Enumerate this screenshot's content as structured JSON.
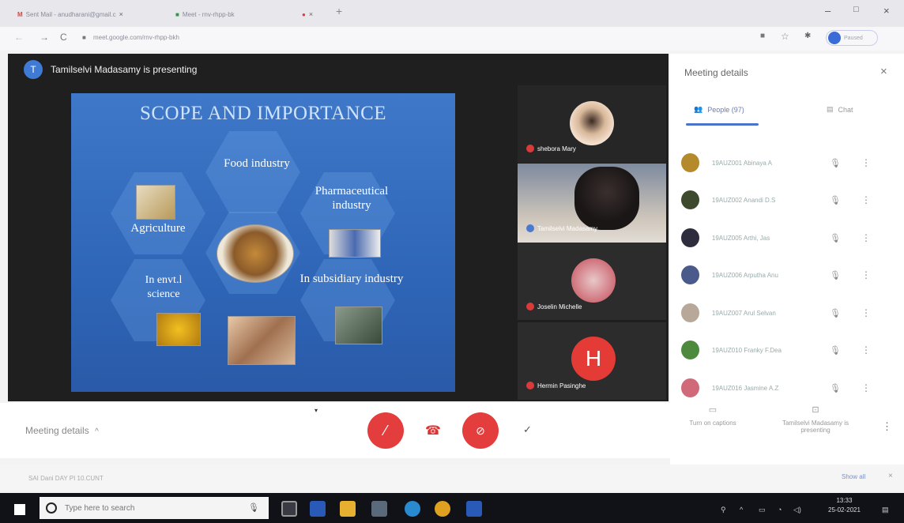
{
  "browser": {
    "tabs": [
      {
        "label": "Sent Mail - anudharani@gmail.c",
        "close": "×"
      },
      {
        "label": "Meet - rnv-rhpp-bk",
        "close": "×"
      }
    ],
    "rec_close": "×",
    "new_tab": "+",
    "window_controls": {
      "min": "–",
      "max": "□",
      "close": "×"
    },
    "nav": {
      "back": "←",
      "forward": "→",
      "reload": "C"
    },
    "url": "meet.google.com/rnv-rhpp-bkh",
    "profile_label": "Paused"
  },
  "meeting": {
    "presenter_initial": "T",
    "presenter_text": "Tamilselvi Madasamy is presenting",
    "slide": {
      "title": "SCOPE AND IMPORTANCE",
      "labels": {
        "food": "Food industry",
        "pharma": "Pharmaceutical industry",
        "agriculture": "Agriculture",
        "envt": "In envt.l science",
        "subsidiary": "In subsidiary industry"
      }
    },
    "tiles": [
      {
        "name": "shebora Mary"
      },
      {
        "name": "Tamilselvi Madasamy"
      },
      {
        "name": "Joselin Michelle"
      },
      {
        "name": "Hermin Pasinghe",
        "initial": "H"
      }
    ],
    "details_label": "Meeting details",
    "details_chevron": "^"
  },
  "panel": {
    "title": "Meeting details",
    "close": "×",
    "tabs": {
      "people": "People (97)",
      "chat": "Chat"
    },
    "people": [
      {
        "name": "19AUZ001 Abinaya A",
        "color": "#b58a2a"
      },
      {
        "name": "19AUZ002 Anandi D.S",
        "color": "#3d4a2e"
      },
      {
        "name": "19AUZ005 Arthi, Jas",
        "color": "#2d2d3d"
      },
      {
        "name": "19AUZ006 Arputha Anu",
        "color": "#4a5a8a"
      },
      {
        "name": "19AUZ007 Arul Selvan",
        "color": "#b8a89a"
      },
      {
        "name": "19AUZ010 Franky F.Dea",
        "color": "#4e8a3e"
      },
      {
        "name": "19AUZ016 Jasmine A.Z",
        "color": "#d06a7a"
      }
    ],
    "actions": {
      "captions": "Turn on captions",
      "presenting": "Tamilselvi Madasamy is presenting"
    }
  },
  "downloads": {
    "item": "SAI Dani DAY PI 10.CUNT",
    "show_all": "Show all",
    "close": "×"
  },
  "taskbar": {
    "search_placeholder": "Type here to search",
    "time": "13:33",
    "date": "25-02-2021"
  }
}
